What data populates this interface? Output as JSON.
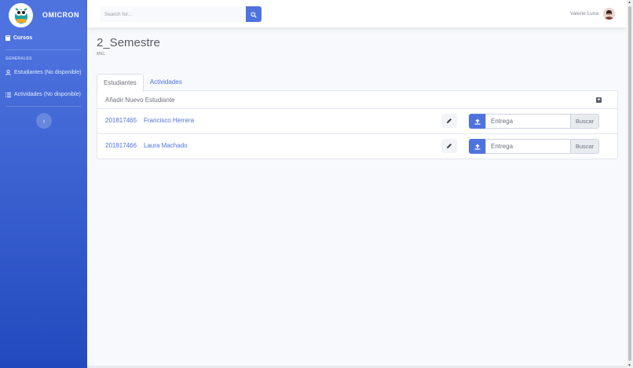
{
  "brand": {
    "name": "OMICRON",
    "logo_icon": "owl-logo-icon"
  },
  "sidebar": {
    "items": [
      {
        "label": "Cursos",
        "icon": "book-icon"
      },
      {
        "label": "Estudiantes (No disponible)",
        "icon": "user-icon"
      },
      {
        "label": "Actividades (No disponible)",
        "icon": "list-icon"
      }
    ],
    "heading": "GENERALES",
    "toggle_icon": "chevron-left-icon"
  },
  "topbar": {
    "search_placeholder": "Search for...",
    "search_icon": "search-icon",
    "user_name": "Valerie Luna"
  },
  "page": {
    "title": "2_Semestre",
    "subtitle": "MEL"
  },
  "tabs": [
    {
      "label": "Estudiantes",
      "active": true
    },
    {
      "label": "Actividades",
      "active": false
    }
  ],
  "card": {
    "add_label": "Añadir Nuevo Estudiante",
    "add_icon": "plus-square-icon",
    "rows": [
      {
        "id": "201817465",
        "name": "Francisco Herrera",
        "file_placeholder": "Entrega",
        "browse_label": "Buscar"
      },
      {
        "id": "201817466",
        "name": "Laura Machado",
        "file_placeholder": "Entrega",
        "browse_label": "Buscar"
      }
    ]
  },
  "colors": {
    "primary": "#4e73df",
    "sidebar_end": "#224abe",
    "background": "#f8f9fc"
  }
}
